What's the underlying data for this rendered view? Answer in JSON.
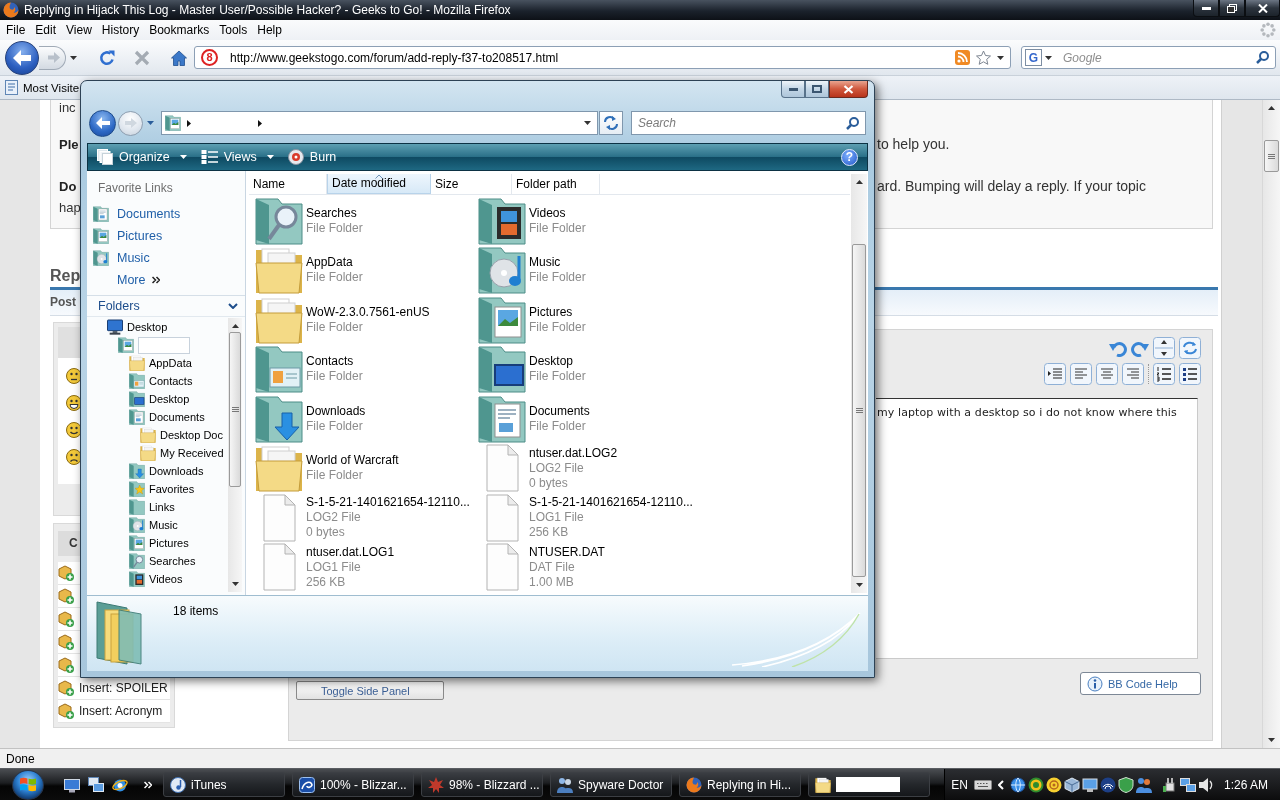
{
  "browser": {
    "title": "Replying in Hijack This Log - Master User/Possible Hacker? - Geeks to Go! - Mozilla Firefox",
    "menu": [
      "File",
      "Edit",
      "View",
      "History",
      "Bookmarks",
      "Tools",
      "Help"
    ],
    "site_icon": "8",
    "url": "http://www.geekstogo.com/forum/add-reply-f37-to208517.html",
    "search": {
      "engine_icon": "G",
      "placeholder": "Google"
    },
    "bookmarks": [
      "Most Visite"
    ],
    "status": "Done"
  },
  "page": {
    "notice": [
      {
        "left": {
          "text": "inc",
          "bold": false
        }
      },
      {
        "left": {
          "text": "Ple",
          "bold": true
        },
        "right": "to help you."
      },
      {
        "left": {
          "text": "Do",
          "bold": true
        },
        "right": "ard. Bumping will delay a reply. If your topic"
      },
      {
        "left": {
          "text": "hap",
          "bold": false
        }
      }
    ],
    "heading": "Rep",
    "tab_bar": "Post",
    "side_header": "C",
    "insert_items": [
      "Insert: SPOILER",
      "Insert: Acronym"
    ],
    "editor_text": "my laptop with a desktop so i do not know where this",
    "toggle_button": "Toggle Side Panel",
    "help_button": "BB Code Help"
  },
  "explorer": {
    "search": {
      "placeholder": "Search"
    },
    "commands": [
      {
        "label": "Organize",
        "kind": "organize",
        "dropdown": true
      },
      {
        "label": "Views",
        "kind": "views",
        "dropdown": true
      },
      {
        "label": "Burn",
        "kind": "burn",
        "dropdown": false
      }
    ],
    "help": "?",
    "favorites_header": "Favorite Links",
    "favorites": [
      {
        "label": "Documents",
        "kind": "documents"
      },
      {
        "label": "Pictures",
        "kind": "pictures"
      },
      {
        "label": "Music",
        "kind": "music"
      }
    ],
    "more": "More",
    "folders_header": "Folders",
    "tree": [
      {
        "label": "Desktop",
        "kind": "monitor",
        "children": [
          {
            "kind": "user",
            "children": [
              {
                "label": "AppData",
                "kind": "folder"
              },
              {
                "label": "Contacts",
                "kind": "contacts"
              },
              {
                "label": "Desktop",
                "kind": "desktop"
              },
              {
                "label": "Documents",
                "kind": "documents",
                "children": [
                  {
                    "label": "Desktop Doc",
                    "kind": "folder"
                  },
                  {
                    "label": "My Received",
                    "kind": "folder"
                  }
                ]
              },
              {
                "label": "Downloads",
                "kind": "downloads"
              },
              {
                "label": "Favorites",
                "kind": "favorites"
              },
              {
                "label": "Links",
                "kind": "links"
              },
              {
                "label": "Music",
                "kind": "music"
              },
              {
                "label": "Pictures",
                "kind": "pictures"
              },
              {
                "label": "Searches",
                "kind": "searches"
              },
              {
                "label": "Videos",
                "kind": "videos"
              }
            ]
          }
        ]
      }
    ],
    "columns": [
      {
        "label": "Name",
        "sorted": false
      },
      {
        "label": "Date modified",
        "sorted": true
      },
      {
        "label": "Size",
        "sorted": false
      },
      {
        "label": "Folder path",
        "sorted": false
      }
    ],
    "items": [
      {
        "name": "Searches",
        "type": "File Folder",
        "kind": "searches"
      },
      {
        "name": "Videos",
        "type": "File Folder",
        "kind": "videos"
      },
      {
        "name": "AppData",
        "type": "File Folder",
        "kind": "folder"
      },
      {
        "name": "Music",
        "type": "File Folder",
        "kind": "music"
      },
      {
        "name": "WoW-2.3.0.7561-enUS",
        "type": "File Folder",
        "kind": "folder"
      },
      {
        "name": "Pictures",
        "type": "File Folder",
        "kind": "pictures"
      },
      {
        "name": "Contacts",
        "type": "File Folder",
        "kind": "contacts"
      },
      {
        "name": "Desktop",
        "type": "File Folder",
        "kind": "desktop"
      },
      {
        "name": "Downloads",
        "type": "File Folder",
        "kind": "downloads"
      },
      {
        "name": "Documents",
        "type": "File Folder",
        "kind": "documents"
      },
      {
        "name": "World of Warcraft",
        "type": "File Folder",
        "kind": "folder"
      },
      {
        "name": "ntuser.dat.LOG2",
        "type": "LOG2 File",
        "size": "0 bytes",
        "kind": "file"
      },
      {
        "name": "S-1-5-21-1401621654-12110...",
        "type": "LOG2 File",
        "size": "0 bytes",
        "kind": "file"
      },
      {
        "name": "S-1-5-21-1401621654-12110...",
        "type": "LOG1 File",
        "size": "256 KB",
        "kind": "file"
      },
      {
        "name": "ntuser.dat.LOG1",
        "type": "LOG1 File",
        "size": "256 KB",
        "kind": "file"
      },
      {
        "name": "NTUSER.DAT",
        "type": "DAT File",
        "size": "1.00 MB",
        "kind": "file"
      }
    ],
    "status": "18 items"
  },
  "taskbar": {
    "buttons": [
      {
        "label": "iTunes",
        "kind": "itunes"
      },
      {
        "label": "100% - Blizzar...",
        "kind": "swirl"
      },
      {
        "label": "98% - Blizzard ...",
        "kind": "downloader"
      },
      {
        "label": "Spyware Doctor",
        "kind": "doctor"
      },
      {
        "label": "Replying in Hi...",
        "kind": "firefox"
      },
      {
        "kind": "folder"
      }
    ],
    "language": "EN",
    "clock": "1:26 AM"
  }
}
